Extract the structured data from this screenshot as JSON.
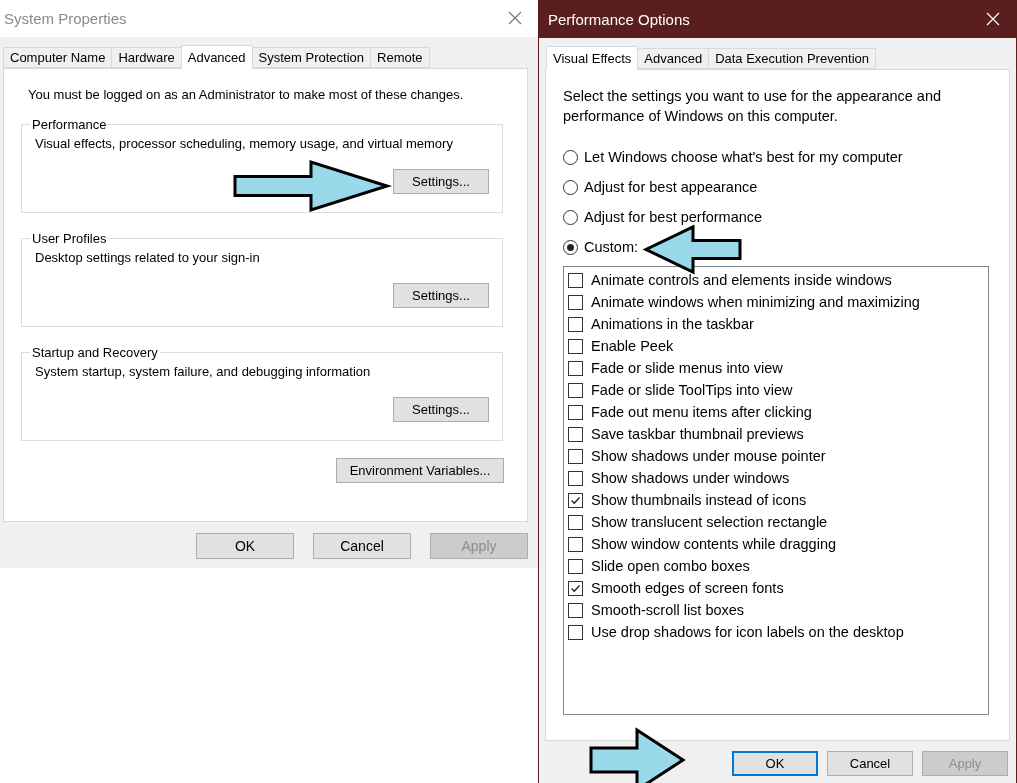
{
  "system_properties": {
    "title": "System Properties",
    "tabs": [
      {
        "label": "Computer Name",
        "selected": false
      },
      {
        "label": "Hardware",
        "selected": false
      },
      {
        "label": "Advanced",
        "selected": true
      },
      {
        "label": "System Protection",
        "selected": false
      },
      {
        "label": "Remote",
        "selected": false
      }
    ],
    "notice": "You must be logged on as an Administrator to make most of these changes.",
    "groups": [
      {
        "title": "Performance",
        "description": "Visual effects, processor scheduling, memory usage, and virtual memory",
        "button": "Settings..."
      },
      {
        "title": "User Profiles",
        "description": "Desktop settings related to your sign-in",
        "button": "Settings..."
      },
      {
        "title": "Startup and Recovery",
        "description": "System startup, system failure, and debugging information",
        "button": "Settings..."
      }
    ],
    "env_button": "Environment Variables...",
    "buttons": [
      {
        "label": "OK",
        "disabled": false
      },
      {
        "label": "Cancel",
        "disabled": false
      },
      {
        "label": "Apply",
        "disabled": true
      }
    ]
  },
  "performance_options": {
    "title": "Performance Options",
    "tabs": [
      {
        "label": "Visual Effects",
        "selected": true
      },
      {
        "label": "Advanced",
        "selected": false
      },
      {
        "label": "Data Execution Prevention",
        "selected": false
      }
    ],
    "intro": "Select the settings you want to use for the appearance and performance of Windows on this computer.",
    "radios": [
      {
        "label": "Let Windows choose what's best for my computer",
        "selected": false
      },
      {
        "label": "Adjust for best appearance",
        "selected": false
      },
      {
        "label": "Adjust for best performance",
        "selected": false
      },
      {
        "label": "Custom:",
        "selected": true
      }
    ],
    "effects": [
      {
        "label": "Animate controls and elements inside windows",
        "checked": false
      },
      {
        "label": "Animate windows when minimizing and maximizing",
        "checked": false
      },
      {
        "label": "Animations in the taskbar",
        "checked": false
      },
      {
        "label": "Enable Peek",
        "checked": false
      },
      {
        "label": "Fade or slide menus into view",
        "checked": false
      },
      {
        "label": "Fade or slide ToolTips into view",
        "checked": false
      },
      {
        "label": "Fade out menu items after clicking",
        "checked": false
      },
      {
        "label": "Save taskbar thumbnail previews",
        "checked": false
      },
      {
        "label": "Show shadows under mouse pointer",
        "checked": false
      },
      {
        "label": "Show shadows under windows",
        "checked": false
      },
      {
        "label": "Show thumbnails instead of icons",
        "checked": true
      },
      {
        "label": "Show translucent selection rectangle",
        "checked": false
      },
      {
        "label": "Show window contents while dragging",
        "checked": false
      },
      {
        "label": "Slide open combo boxes",
        "checked": false
      },
      {
        "label": "Smooth edges of screen fonts",
        "checked": true
      },
      {
        "label": "Smooth-scroll list boxes",
        "checked": false
      },
      {
        "label": "Use drop shadows for icon labels on the desktop",
        "checked": false
      }
    ],
    "buttons": [
      {
        "label": "OK",
        "disabled": false,
        "focused": true
      },
      {
        "label": "Cancel",
        "disabled": false,
        "focused": false
      },
      {
        "label": "Apply",
        "disabled": true,
        "focused": false
      }
    ]
  }
}
